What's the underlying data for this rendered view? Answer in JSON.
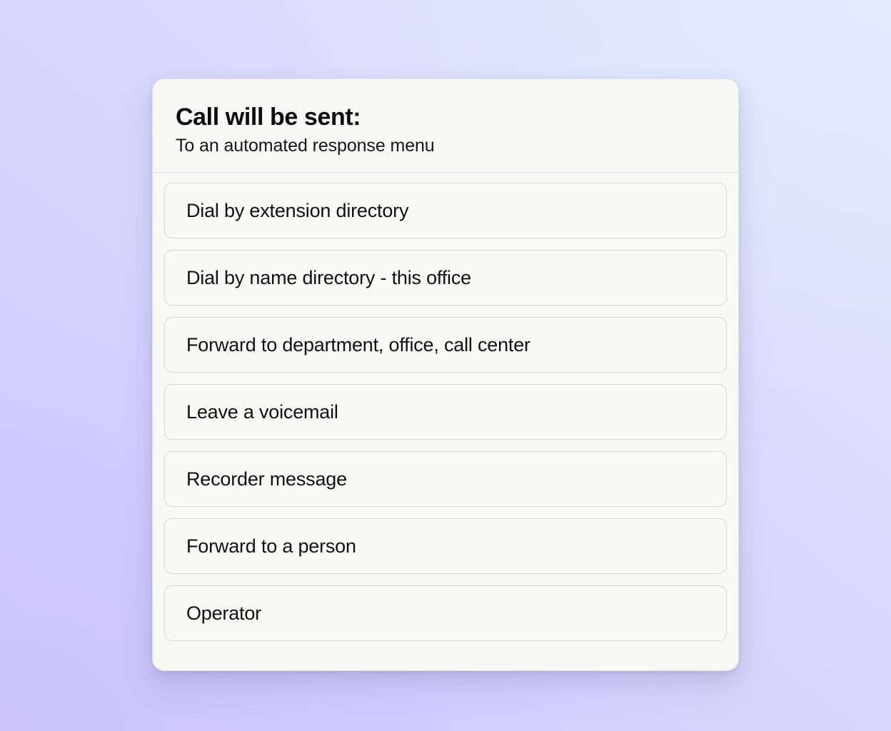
{
  "background": {
    "gradient_from": "#e0e7fd",
    "gradient_to": "#cfc8fd"
  },
  "card": {
    "background_color": "#f8f8f7",
    "border_color": "#e4e2ea",
    "header": {
      "title": "Call will be sent:",
      "subtitle": "To an automated response menu"
    },
    "options": [
      {
        "label": "Dial by extension directory"
      },
      {
        "label": "Dial by name directory - this office"
      },
      {
        "label": "Forward to department, office, call center"
      },
      {
        "label": "Leave a voicemail"
      },
      {
        "label": "Recorder message"
      },
      {
        "label": "Forward to a person"
      },
      {
        "label": "Operator"
      }
    ]
  }
}
